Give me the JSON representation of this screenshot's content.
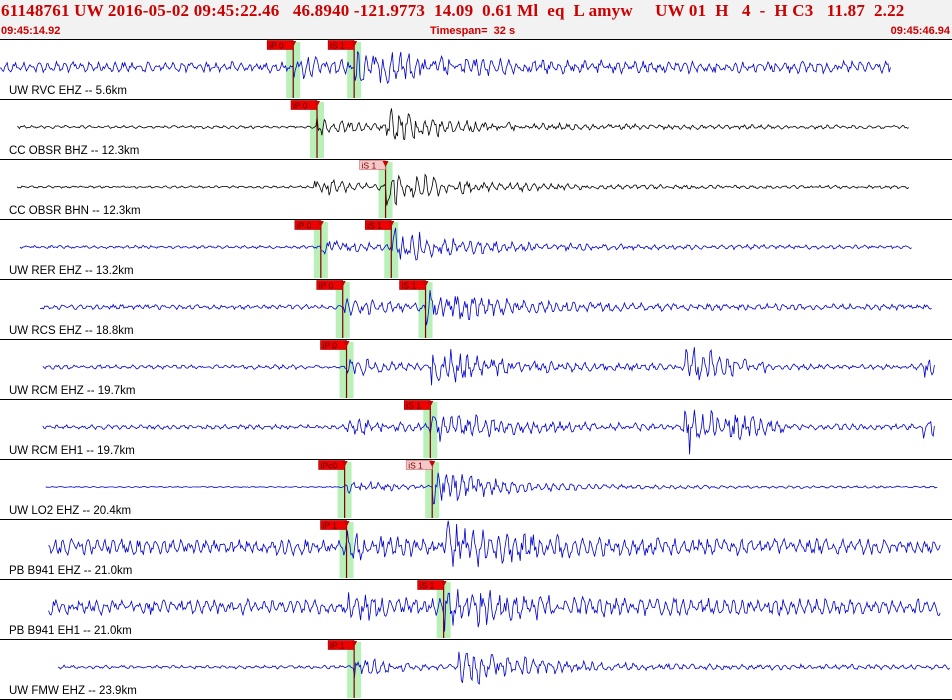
{
  "header": {
    "event_line": "61148761 UW 2016-05-02 09:45:22.46   46.8940 -121.9773  14.09  0.61 Ml  eq  L amyw     UW 01  H   4  -  H C3   11.87  2.22",
    "start_time": "09:45:14.92",
    "timespan": "Timespan=  32 s",
    "end_time": "09:45:46.94"
  },
  "colors": {
    "header_text": "#cc0000",
    "trace_blue": "#0000cc",
    "trace_black": "#000000",
    "pick_flag_red": "#ee0000",
    "pick_flag_pink": "#f4c8c8",
    "pick_window_green": "#b8f0b8",
    "pick_line": "#800000"
  },
  "channels": [
    {
      "label": "UW RVC EHZ -- 5.6km",
      "color": "blue",
      "amp": 0.55,
      "noise": 0.18,
      "start": 0.0,
      "end": 0.936,
      "p_pick": {
        "label": "iP 0",
        "x": 0.308,
        "style": "red"
      },
      "s_pick": {
        "label": "iS 1",
        "x": 0.372,
        "style": "red"
      },
      "bursts": []
    },
    {
      "label": "CC OBSR BHZ -- 12.3km",
      "color": "black",
      "amp": 0.55,
      "noise": 0.05,
      "start": 0.018,
      "end": 0.955,
      "p_pick": {
        "label": "iP 0",
        "x": 0.333,
        "style": "red"
      },
      "s_pick": {
        "label": "",
        "x": 0.405,
        "style": "none"
      },
      "bursts": []
    },
    {
      "label": "CC OBSR BHN -- 12.3km",
      "color": "black",
      "amp": 0.55,
      "noise": 0.04,
      "start": 0.018,
      "end": 0.955,
      "p_pick": {
        "label": "",
        "x": 0.33,
        "style": "none"
      },
      "s_pick": {
        "label": "iS 1",
        "x": 0.405,
        "style": "pink"
      },
      "bursts": []
    },
    {
      "label": "UW RER EHZ -- 13.2km",
      "color": "blue",
      "amp": 0.55,
      "noise": 0.05,
      "start": 0.021,
      "end": 0.958,
      "p_pick": {
        "label": "iP 0",
        "x": 0.337,
        "style": "red"
      },
      "s_pick": {
        "label": "iS 1",
        "x": 0.411,
        "style": "red"
      },
      "bursts": []
    },
    {
      "label": "UW RCS EHZ -- 18.8km",
      "color": "blue",
      "amp": 0.6,
      "noise": 0.08,
      "start": 0.042,
      "end": 0.979,
      "p_pick": {
        "label": "iP 0",
        "x": 0.36,
        "style": "red"
      },
      "s_pick": {
        "label": "iS 1",
        "x": 0.447,
        "style": "red"
      },
      "bursts": []
    },
    {
      "label": "UW RCM EHZ -- 19.7km",
      "color": "blue",
      "amp": 0.55,
      "noise": 0.07,
      "start": 0.045,
      "end": 0.982,
      "p_pick": {
        "label": "iP 0",
        "x": 0.364,
        "style": "red"
      },
      "s_pick": {
        "label": "",
        "x": 0.453,
        "style": "none"
      },
      "bursts": [
        {
          "x": 0.717,
          "amp": 0.75,
          "dur": 0.05
        },
        {
          "x": 0.967,
          "amp": 0.55,
          "dur": 0.015
        }
      ]
    },
    {
      "label": "UW RCM EH1 -- 19.7km",
      "color": "blue",
      "amp": 0.5,
      "noise": 0.08,
      "start": 0.045,
      "end": 0.982,
      "p_pick": {
        "label": "",
        "x": 0.364,
        "style": "none"
      },
      "s_pick": {
        "label": "iS 1",
        "x": 0.452,
        "style": "red"
      },
      "bursts": [
        {
          "x": 0.717,
          "amp": 0.85,
          "dur": 0.06
        },
        {
          "x": 0.967,
          "amp": 0.55,
          "dur": 0.015
        }
      ]
    },
    {
      "label": "UW LO2 EHZ -- 20.4km",
      "color": "blue",
      "amp": 0.55,
      "noise": 0.02,
      "start": 0.048,
      "end": 0.985,
      "p_pick": {
        "label": "iPc0",
        "x": 0.362,
        "style": "red"
      },
      "s_pick": {
        "label": "iS 1",
        "x": 0.454,
        "style": "pink"
      },
      "bursts": []
    },
    {
      "label": "PB B941 EHZ -- 21.0km",
      "color": "blue",
      "amp": 0.6,
      "noise": 0.25,
      "start": 0.051,
      "end": 0.988,
      "p_pick": {
        "label": "iP 1",
        "x": 0.364,
        "style": "red"
      },
      "s_pick": {
        "label": "",
        "x": 0.466,
        "style": "none"
      },
      "bursts": []
    },
    {
      "label": "PB B941 EH1 -- 21.0km",
      "color": "blue",
      "amp": 0.55,
      "noise": 0.25,
      "start": 0.051,
      "end": 0.988,
      "p_pick": {
        "label": "",
        "x": 0.364,
        "style": "none"
      },
      "s_pick": {
        "label": "iS 1",
        "x": 0.466,
        "style": "red"
      },
      "bursts": []
    },
    {
      "label": "UW FMW EHZ -- 23.9km",
      "color": "blue",
      "amp": 0.6,
      "noise": 0.06,
      "start": 0.061,
      "end": 0.998,
      "p_pick": {
        "label": "iP 1",
        "x": 0.372,
        "style": "red"
      },
      "s_pick": {
        "label": "",
        "x": 0.481,
        "style": "none"
      },
      "bursts": []
    }
  ]
}
